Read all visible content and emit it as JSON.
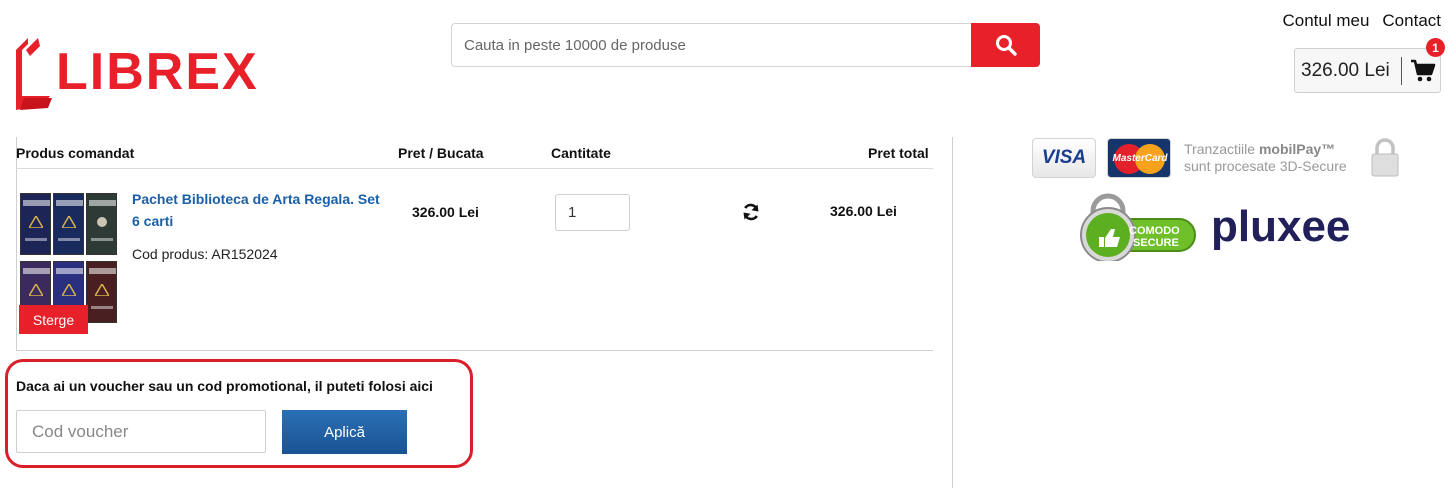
{
  "brand": {
    "logo_text": "LIBREX",
    "accent": "#e8202a"
  },
  "search": {
    "placeholder": "Cauta in peste 10000 de produse"
  },
  "header": {
    "links": [
      "Contul meu",
      "Contact"
    ],
    "cart_total": "326.00 Lei",
    "cart_count": "1"
  },
  "table": {
    "headers": {
      "product": "Produs comandat",
      "unit_price": "Pret / Bucata",
      "quantity": "Cantitate",
      "total": "Pret total"
    },
    "rows": [
      {
        "name": "Pachet Biblioteca de Arta Regala. Set 6 carti",
        "code": "Cod produs: AR152024",
        "unit_price": "326.00 Lei",
        "quantity": "1",
        "total": "326.00 Lei",
        "delete_label": "Sterge"
      }
    ]
  },
  "voucher": {
    "title": "Daca ai un voucher sau un cod promotional, il puteti folosi aici",
    "placeholder": "Cod voucher",
    "apply_label": "Aplică"
  },
  "trust": {
    "visa": "VISA",
    "mastercard": "MasterCard",
    "mobilpay_line1_prefix": "Tranzactiile ",
    "mobilpay_brand": "mobilPay™",
    "mobilpay_line2": "sunt procesate 3D-Secure",
    "comodo_line1": "COMODO",
    "comodo_line2": "SECURE",
    "pluxee": "pluxee"
  }
}
